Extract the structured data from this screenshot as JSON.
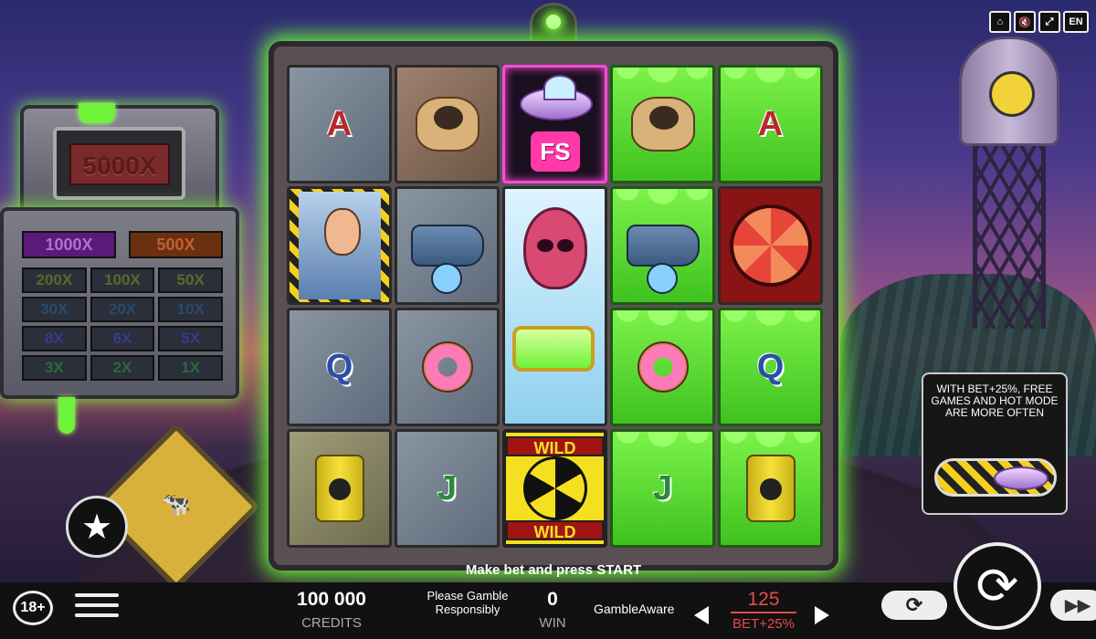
{
  "top_buttons": {
    "home": "⌂",
    "sound": "🔇",
    "fullscreen": "⤢",
    "language": "EN"
  },
  "paytable": {
    "top": "5000X",
    "row1": [
      "1000X",
      "500X"
    ],
    "grid": [
      "200X",
      "100X",
      "50X",
      "30X",
      "20X",
      "10X",
      "8X",
      "6X",
      "5X",
      "3X",
      "2X",
      "1X"
    ]
  },
  "reels": {
    "letters": {
      "A": "A",
      "Q": "Q",
      "J": "J"
    },
    "fs": "FS",
    "wild": "WILD"
  },
  "message": "Make bet and press START",
  "promo": {
    "text": "WITH BET+25%, FREE GAMES AND HOT MODE ARE MORE OFTEN"
  },
  "bottom": {
    "age": "18+",
    "credits_value": "100 000",
    "credits_label": "CREDITS",
    "gamble_text": "Please Gamble Responsibly",
    "win_value": "0",
    "win_label": "WIN",
    "gambleaware": "GambleAware",
    "bet_value": "125",
    "bet_label": "BET+25%",
    "auto_icon": "⟳",
    "spin_icon": "⟳",
    "ff_icon": "▶▶"
  },
  "colors": {
    "slime": "#6ef23a",
    "bet_red": "#e84a4a"
  }
}
